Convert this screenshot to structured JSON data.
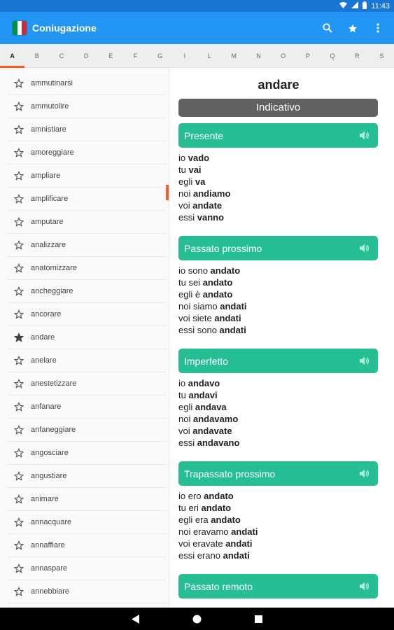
{
  "status_bar": {
    "time": "11:43"
  },
  "app": {
    "title": "Coniugazione",
    "flag_colors": [
      "#009246",
      "#ffffff",
      "#ce2b37"
    ]
  },
  "colors": {
    "primary": "#2196f3",
    "accent": "#ff5722",
    "tense": "#26bf94",
    "mood": "#616161"
  },
  "alphabet": [
    "A",
    "B",
    "C",
    "D",
    "E",
    "F",
    "G",
    "I",
    "L",
    "M",
    "N",
    "O",
    "P",
    "Q",
    "R",
    "S"
  ],
  "active_letter": "A",
  "verbs": [
    {
      "label": "ammutinarsi",
      "starred": false
    },
    {
      "label": "ammutolire",
      "starred": false
    },
    {
      "label": "amnistiare",
      "starred": false
    },
    {
      "label": "amoreggiare",
      "starred": false
    },
    {
      "label": "ampliare",
      "starred": false
    },
    {
      "label": "amplificare",
      "starred": false
    },
    {
      "label": "amputare",
      "starred": false
    },
    {
      "label": "analizzare",
      "starred": false
    },
    {
      "label": "anatomizzare",
      "starred": false
    },
    {
      "label": "ancheggiare",
      "starred": false
    },
    {
      "label": "ancorare",
      "starred": false
    },
    {
      "label": "andare",
      "starred": true
    },
    {
      "label": "anelare",
      "starred": false
    },
    {
      "label": "anestetizzare",
      "starred": false
    },
    {
      "label": "anfanare",
      "starred": false
    },
    {
      "label": "anfaneggiare",
      "starred": false
    },
    {
      "label": "angosciare",
      "starred": false
    },
    {
      "label": "angustiare",
      "starred": false
    },
    {
      "label": "animare",
      "starred": false
    },
    {
      "label": "annacquare",
      "starred": false
    },
    {
      "label": "annaffiare",
      "starred": false
    },
    {
      "label": "annaspare",
      "starred": false
    },
    {
      "label": "annebbiare",
      "starred": false
    }
  ],
  "detail": {
    "verb": "andare",
    "mood": "Indicativo",
    "tenses": [
      {
        "name": "Presente",
        "forms": [
          {
            "pre": "io ",
            "verb": "vado"
          },
          {
            "pre": "tu ",
            "verb": "vai"
          },
          {
            "pre": "egli ",
            "verb": "va"
          },
          {
            "pre": "noi ",
            "verb": "andiamo"
          },
          {
            "pre": "voi ",
            "verb": "andate"
          },
          {
            "pre": "essi ",
            "verb": "vanno"
          }
        ]
      },
      {
        "name": "Passato prossimo",
        "forms": [
          {
            "pre": "io sono ",
            "verb": "andato"
          },
          {
            "pre": "tu sei ",
            "verb": "andato"
          },
          {
            "pre": "egli è ",
            "verb": "andato"
          },
          {
            "pre": "noi siamo ",
            "verb": "andati"
          },
          {
            "pre": "voi siete ",
            "verb": "andati"
          },
          {
            "pre": "essi sono ",
            "verb": "andati"
          }
        ]
      },
      {
        "name": "Imperfetto",
        "forms": [
          {
            "pre": "io ",
            "verb": "andavo"
          },
          {
            "pre": "tu ",
            "verb": "andavi"
          },
          {
            "pre": "egli ",
            "verb": "andava"
          },
          {
            "pre": "noi ",
            "verb": "andavamo"
          },
          {
            "pre": "voi ",
            "verb": "andavate"
          },
          {
            "pre": "essi ",
            "verb": "andavano"
          }
        ]
      },
      {
        "name": "Trapassato prossimo",
        "forms": [
          {
            "pre": "io ero ",
            "verb": "andato"
          },
          {
            "pre": "tu eri ",
            "verb": "andato"
          },
          {
            "pre": "egli era ",
            "verb": "andato"
          },
          {
            "pre": "noi eravamo ",
            "verb": "andati"
          },
          {
            "pre": "voi eravate ",
            "verb": "andati"
          },
          {
            "pre": "essi erano ",
            "verb": "andati"
          }
        ]
      },
      {
        "name": "Passato remoto",
        "forms": []
      }
    ]
  }
}
